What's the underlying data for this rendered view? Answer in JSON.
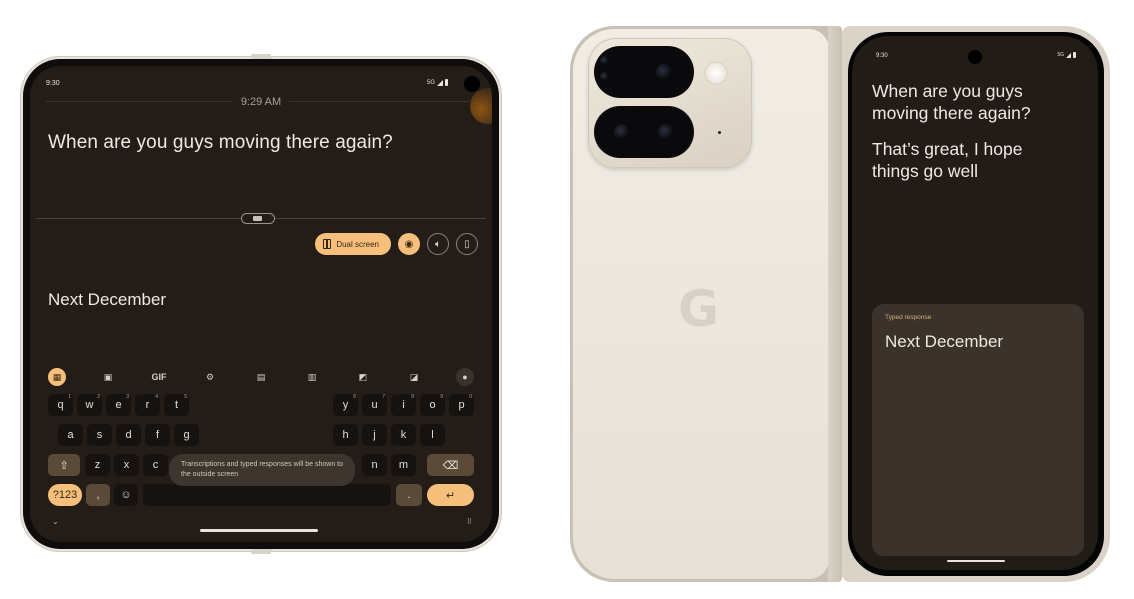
{
  "inner_screen": {
    "status_time": "9:30",
    "network": "5G",
    "timestamp": "9:29 AM",
    "transcription": "When are you guys moving there again?",
    "typed_response": "Next December",
    "actions": {
      "dual_screen_label": "Dual screen",
      "eye_icon": "visibility-icon",
      "speaker_icon": "volume-icon",
      "delete_icon": "trash-icon"
    },
    "toolbar": {
      "apps": "apps-icon",
      "sticker": "sticker-icon",
      "gif": "GIF",
      "settings": "gear-icon",
      "keyboard1": "keyboard-icon",
      "keyboard2": "keyboard-split-icon",
      "resize1": "resize-icon",
      "resize2": "floating-icon",
      "mic": "mic-icon"
    },
    "keyboard": {
      "row1_left": [
        {
          "k": "q",
          "n": "1"
        },
        {
          "k": "w",
          "n": "2"
        },
        {
          "k": "e",
          "n": "3"
        },
        {
          "k": "r",
          "n": "4"
        },
        {
          "k": "t",
          "n": "5"
        }
      ],
      "row1_right": [
        {
          "k": "y",
          "n": "6"
        },
        {
          "k": "u",
          "n": "7"
        },
        {
          "k": "i",
          "n": "8"
        },
        {
          "k": "o",
          "n": "9"
        },
        {
          "k": "p",
          "n": "0"
        }
      ],
      "row2_left": [
        "a",
        "s",
        "d",
        "f",
        "g"
      ],
      "row2_right": [
        "h",
        "j",
        "k",
        "l"
      ],
      "row3_left": [
        "z",
        "x",
        "c"
      ],
      "row3_right": [
        "n",
        "m"
      ],
      "shift": "⇧",
      "backspace": "⌫",
      "symbols": "?123",
      "comma": ",",
      "emoji": "☺",
      "period": ".",
      "enter": "↵"
    },
    "toast": "Transcriptions and typed responses will be shown to the outside screen",
    "collapse": "⌄",
    "keyboard_switch": "⠿"
  },
  "back": {
    "logo": "G"
  },
  "outer_screen": {
    "status_time": "9:30",
    "network": "5G",
    "transcription": "When are you guys moving there again?",
    "reply": "That’s great, I hope things go well",
    "typed_label": "Typed response",
    "typed_response": "Next December"
  }
}
